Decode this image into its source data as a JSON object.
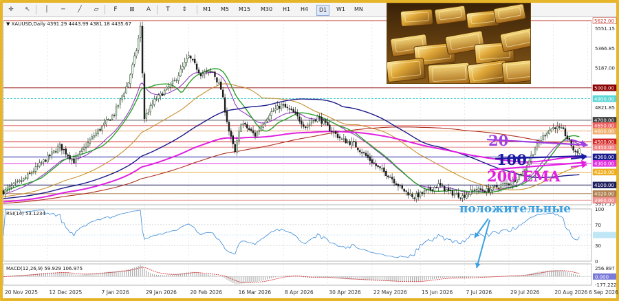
{
  "toolbar": {
    "tools": [
      {
        "icon": "crosshair-icon",
        "glyph": "✛"
      },
      {
        "icon": "cursor-icon",
        "glyph": "↖"
      },
      {
        "icon": "vertical-line-icon",
        "glyph": "│"
      },
      {
        "icon": "horizontal-line-icon",
        "glyph": "─"
      },
      {
        "icon": "trendline-icon",
        "glyph": "╱"
      },
      {
        "icon": "channel-icon",
        "glyph": "▱"
      },
      {
        "icon": "fibonacci-icon",
        "glyph": "F"
      },
      {
        "icon": "shapes-icon",
        "glyph": "⊞"
      },
      {
        "icon": "text-icon",
        "glyph": "A"
      },
      {
        "icon": "label-icon",
        "glyph": "T"
      },
      {
        "icon": "arrows-icon",
        "glyph": "⇕"
      }
    ],
    "timeframes": [
      "M1",
      "M5",
      "M15",
      "M30",
      "H1",
      "H4",
      "D1",
      "W1",
      "MN"
    ],
    "active_timeframe": "D1"
  },
  "chart_data": {
    "type": "line",
    "title": "XAUUSD,Daily  4391.29 4443.99 4381.18 4435.67",
    "ylim": [
      3917.15,
      5622.0
    ],
    "x_ticks": [
      {
        "label": "20 Nov 2025",
        "day": 0
      },
      {
        "label": "12 Dec 2025",
        "day": 22
      },
      {
        "label": "7 Jan 2026",
        "day": 48
      },
      {
        "label": "29 Jan 2026",
        "day": 70
      },
      {
        "label": "20 Feb 2026",
        "day": 92
      },
      {
        "label": "16 Mar 2026",
        "day": 116
      },
      {
        "label": "8 Apr 2026",
        "day": 139
      },
      {
        "label": "30 Apr 2026",
        "day": 161
      },
      {
        "label": "22 May 2026",
        "day": 183
      },
      {
        "label": "15 Jun 2026",
        "day": 207
      },
      {
        "label": "7 Jul 2026",
        "day": 229
      },
      {
        "label": "29 Jul 2026",
        "day": 251
      },
      {
        "label": "20 Aug 2026",
        "day": 273
      },
      {
        "label": "6 Sep 2026",
        "day": 290
      }
    ],
    "y_axis_labels": [
      "5622.00",
      "5551.15",
      "5366.85",
      "5187.00",
      "5000.00",
      "4900.00",
      "4821.85",
      "4700.00",
      "4650.00",
      "4600.00",
      "4500.00",
      "4450.00",
      "4360.00",
      "4300.00",
      "4220.00",
      "4100.00",
      "4020.00",
      "3960.00",
      "3917.15"
    ],
    "levels": [
      {
        "price": 5622,
        "label": "5622.00",
        "color": "#c0392b",
        "bg": "#ffffff",
        "fg": "#c0392b",
        "style": "solid"
      },
      {
        "price": 5000,
        "label": "5000.00",
        "color": "#8b0000",
        "bg": "#8b0000",
        "fg": "#ffffff",
        "style": "solid"
      },
      {
        "price": 4900,
        "label": "4900.00",
        "color": "#40d0d0",
        "bg": "#5fd6d6",
        "fg": "#ffffff",
        "style": "dash"
      },
      {
        "price": 4700,
        "label": "4700.00",
        "color": "#404040",
        "bg": "#404040",
        "fg": "#ffffff",
        "style": "solid"
      },
      {
        "price": 4650,
        "label": "4650.00",
        "color": "#e05050",
        "bg": "#f06060",
        "fg": "#ffffff",
        "style": "solid"
      },
      {
        "price": 4600,
        "label": "4600.00",
        "color": "#e8a060",
        "bg": "#f0b070",
        "fg": "#ffffff",
        "style": "solid"
      },
      {
        "price": 4500,
        "label": "4500.00",
        "color": "#d02020",
        "bg": "#d02020",
        "fg": "#ffffff",
        "style": "solid"
      },
      {
        "price": 4450,
        "label": "4450.00",
        "color": "#e07070",
        "bg": "#f08080",
        "fg": "#ffffff",
        "style": "solid"
      },
      {
        "price": 4360,
        "label": "4360.00",
        "color": "#1a1aa0",
        "bg": "#1a1a8a",
        "fg": "#ffffff",
        "style": "solid"
      },
      {
        "price": 4300,
        "label": "4300.00",
        "color": "#e020e0",
        "bg": "#e030e0",
        "fg": "#ffffff",
        "style": "solid"
      },
      {
        "price": 4220,
        "label": "4220.00",
        "color": "#e0a020",
        "bg": "#f0b020",
        "fg": "#ffffff",
        "style": "solid"
      },
      {
        "price": 4100,
        "label": "4100.00",
        "color": "#202060",
        "bg": "#202060",
        "fg": "#ffffff",
        "style": "solid"
      },
      {
        "price": 4020,
        "label": "4020.00",
        "color": "#a07040",
        "bg": "#b08050",
        "fg": "#ffffff",
        "style": "solid"
      },
      {
        "price": 3960,
        "label": "3960.00",
        "color": "#e08080",
        "bg": "#f09090",
        "fg": "#ffffff",
        "style": "solid"
      }
    ],
    "anchors": [
      [
        0,
        4040
      ],
      [
        10,
        4150
      ],
      [
        20,
        4320
      ],
      [
        28,
        4460
      ],
      [
        35,
        4320
      ],
      [
        45,
        4560
      ],
      [
        55,
        4760
      ],
      [
        62,
        5050
      ],
      [
        66,
        5350
      ],
      [
        68,
        5560
      ],
      [
        70,
        4720
      ],
      [
        75,
        4880
      ],
      [
        85,
        5060
      ],
      [
        92,
        5290
      ],
      [
        98,
        5130
      ],
      [
        104,
        5150
      ],
      [
        108,
        4990
      ],
      [
        112,
        4600
      ],
      [
        115,
        4400
      ],
      [
        118,
        4680
      ],
      [
        125,
        4560
      ],
      [
        132,
        4760
      ],
      [
        138,
        4840
      ],
      [
        144,
        4770
      ],
      [
        150,
        4640
      ],
      [
        156,
        4730
      ],
      [
        162,
        4620
      ],
      [
        168,
        4520
      ],
      [
        174,
        4480
      ],
      [
        180,
        4370
      ],
      [
        186,
        4260
      ],
      [
        192,
        4180
      ],
      [
        198,
        4060
      ],
      [
        204,
        3990
      ],
      [
        210,
        4040
      ],
      [
        216,
        4100
      ],
      [
        222,
        4030
      ],
      [
        228,
        3995
      ],
      [
        234,
        4060
      ],
      [
        240,
        4050
      ],
      [
        246,
        4090
      ],
      [
        252,
        4120
      ],
      [
        258,
        4220
      ],
      [
        264,
        4440
      ],
      [
        270,
        4600
      ],
      [
        274,
        4640
      ],
      [
        278,
        4600
      ],
      [
        282,
        4470
      ],
      [
        284,
        4390
      ],
      [
        286,
        4436
      ]
    ],
    "series": [
      {
        "name": "20",
        "color": "#2aa02a",
        "period": 20,
        "kind": "sma"
      },
      {
        "name": "100",
        "color": "#1a1a8a",
        "period": 100,
        "kind": "sma"
      },
      {
        "name": "200 EMA",
        "color": "#e020e0",
        "period": 200,
        "kind": "ema"
      }
    ],
    "extra_ma": [
      {
        "color": "#9040c0",
        "period": 20,
        "kind": "ema"
      },
      {
        "color": "#c89030",
        "period": 60,
        "kind": "sma"
      },
      {
        "color": "#b03020",
        "period": 200,
        "kind": "sma"
      }
    ],
    "rsi": {
      "label": "RSI(14) 53.1234",
      "ylim": [
        0,
        100
      ],
      "levels": [
        {
          "label": "100",
          "value": 100
        },
        {
          "label": "70",
          "value": 70
        },
        {
          "label": "50.0000",
          "value": 50
        },
        {
          "label": "30",
          "value": 30
        },
        {
          "label": "0",
          "value": 0
        }
      ]
    },
    "macd": {
      "label": "MACD(12,26,9) 59.929 106.975",
      "ylim": [
        -177.222,
        256.897
      ],
      "axis_labels": [
        "256.897",
        "0.000",
        "-177.222"
      ]
    }
  },
  "annotations": {
    "ma20": {
      "text": "20",
      "color": "#a040e0"
    },
    "ma100": {
      "text": "100",
      "color": "#1a1aa0"
    },
    "ema200": {
      "text": "200 EMA",
      "color": "#e020e0"
    },
    "positive": {
      "text": "положительные",
      "color": "#3aa0e0"
    }
  },
  "colors": {
    "frame": "#e7b52a",
    "candle_up": "#2a5a2a",
    "candle_down": "#1a1a1a"
  }
}
